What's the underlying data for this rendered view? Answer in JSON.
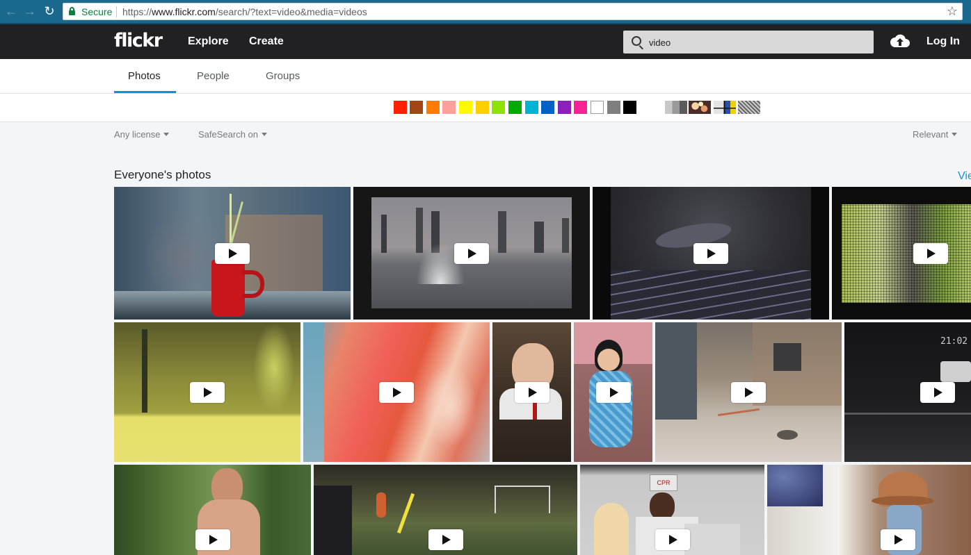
{
  "browser": {
    "back_icon": "arrow-left-icon",
    "forward_icon": "arrow-right-icon",
    "reload_icon": "reload-icon",
    "secure_label": "Secure",
    "url_scheme": "https://",
    "url_host": "www.flickr.com",
    "url_path": "/search/?text=video&media=videos",
    "bookmark_icon": "star-icon"
  },
  "header": {
    "logo": "flickr",
    "nav": [
      "Explore",
      "Create"
    ],
    "search_value": "video",
    "upload_icon": "cloud-upload-icon",
    "login_label": "Log In"
  },
  "tabs": [
    {
      "label": "Photos",
      "active": true
    },
    {
      "label": "People",
      "active": false
    },
    {
      "label": "Groups",
      "active": false
    }
  ],
  "color_swatches": [
    "#ff2000",
    "#a24615",
    "#ff7c00",
    "#ff9f9c",
    "#fffa00",
    "#ffcf00",
    "#90e200",
    "#00ab00",
    "#00b2d4",
    "#0062c6",
    "#8c20ba",
    "#f52394",
    "#ffffff",
    "#7e7e7e",
    "#000000"
  ],
  "style_filters": [
    "black-and-white",
    "shallow-depth-of-field",
    "minimalist",
    "patterns"
  ],
  "filters": {
    "license": "Any license",
    "safesearch": "SafeSearch on",
    "sort": "Relevant"
  },
  "section": {
    "title": "Everyone's photos",
    "view_all": "Vie"
  },
  "tile_overlay_texts": {
    "timestamp": "21:02",
    "sign": "CPR"
  }
}
